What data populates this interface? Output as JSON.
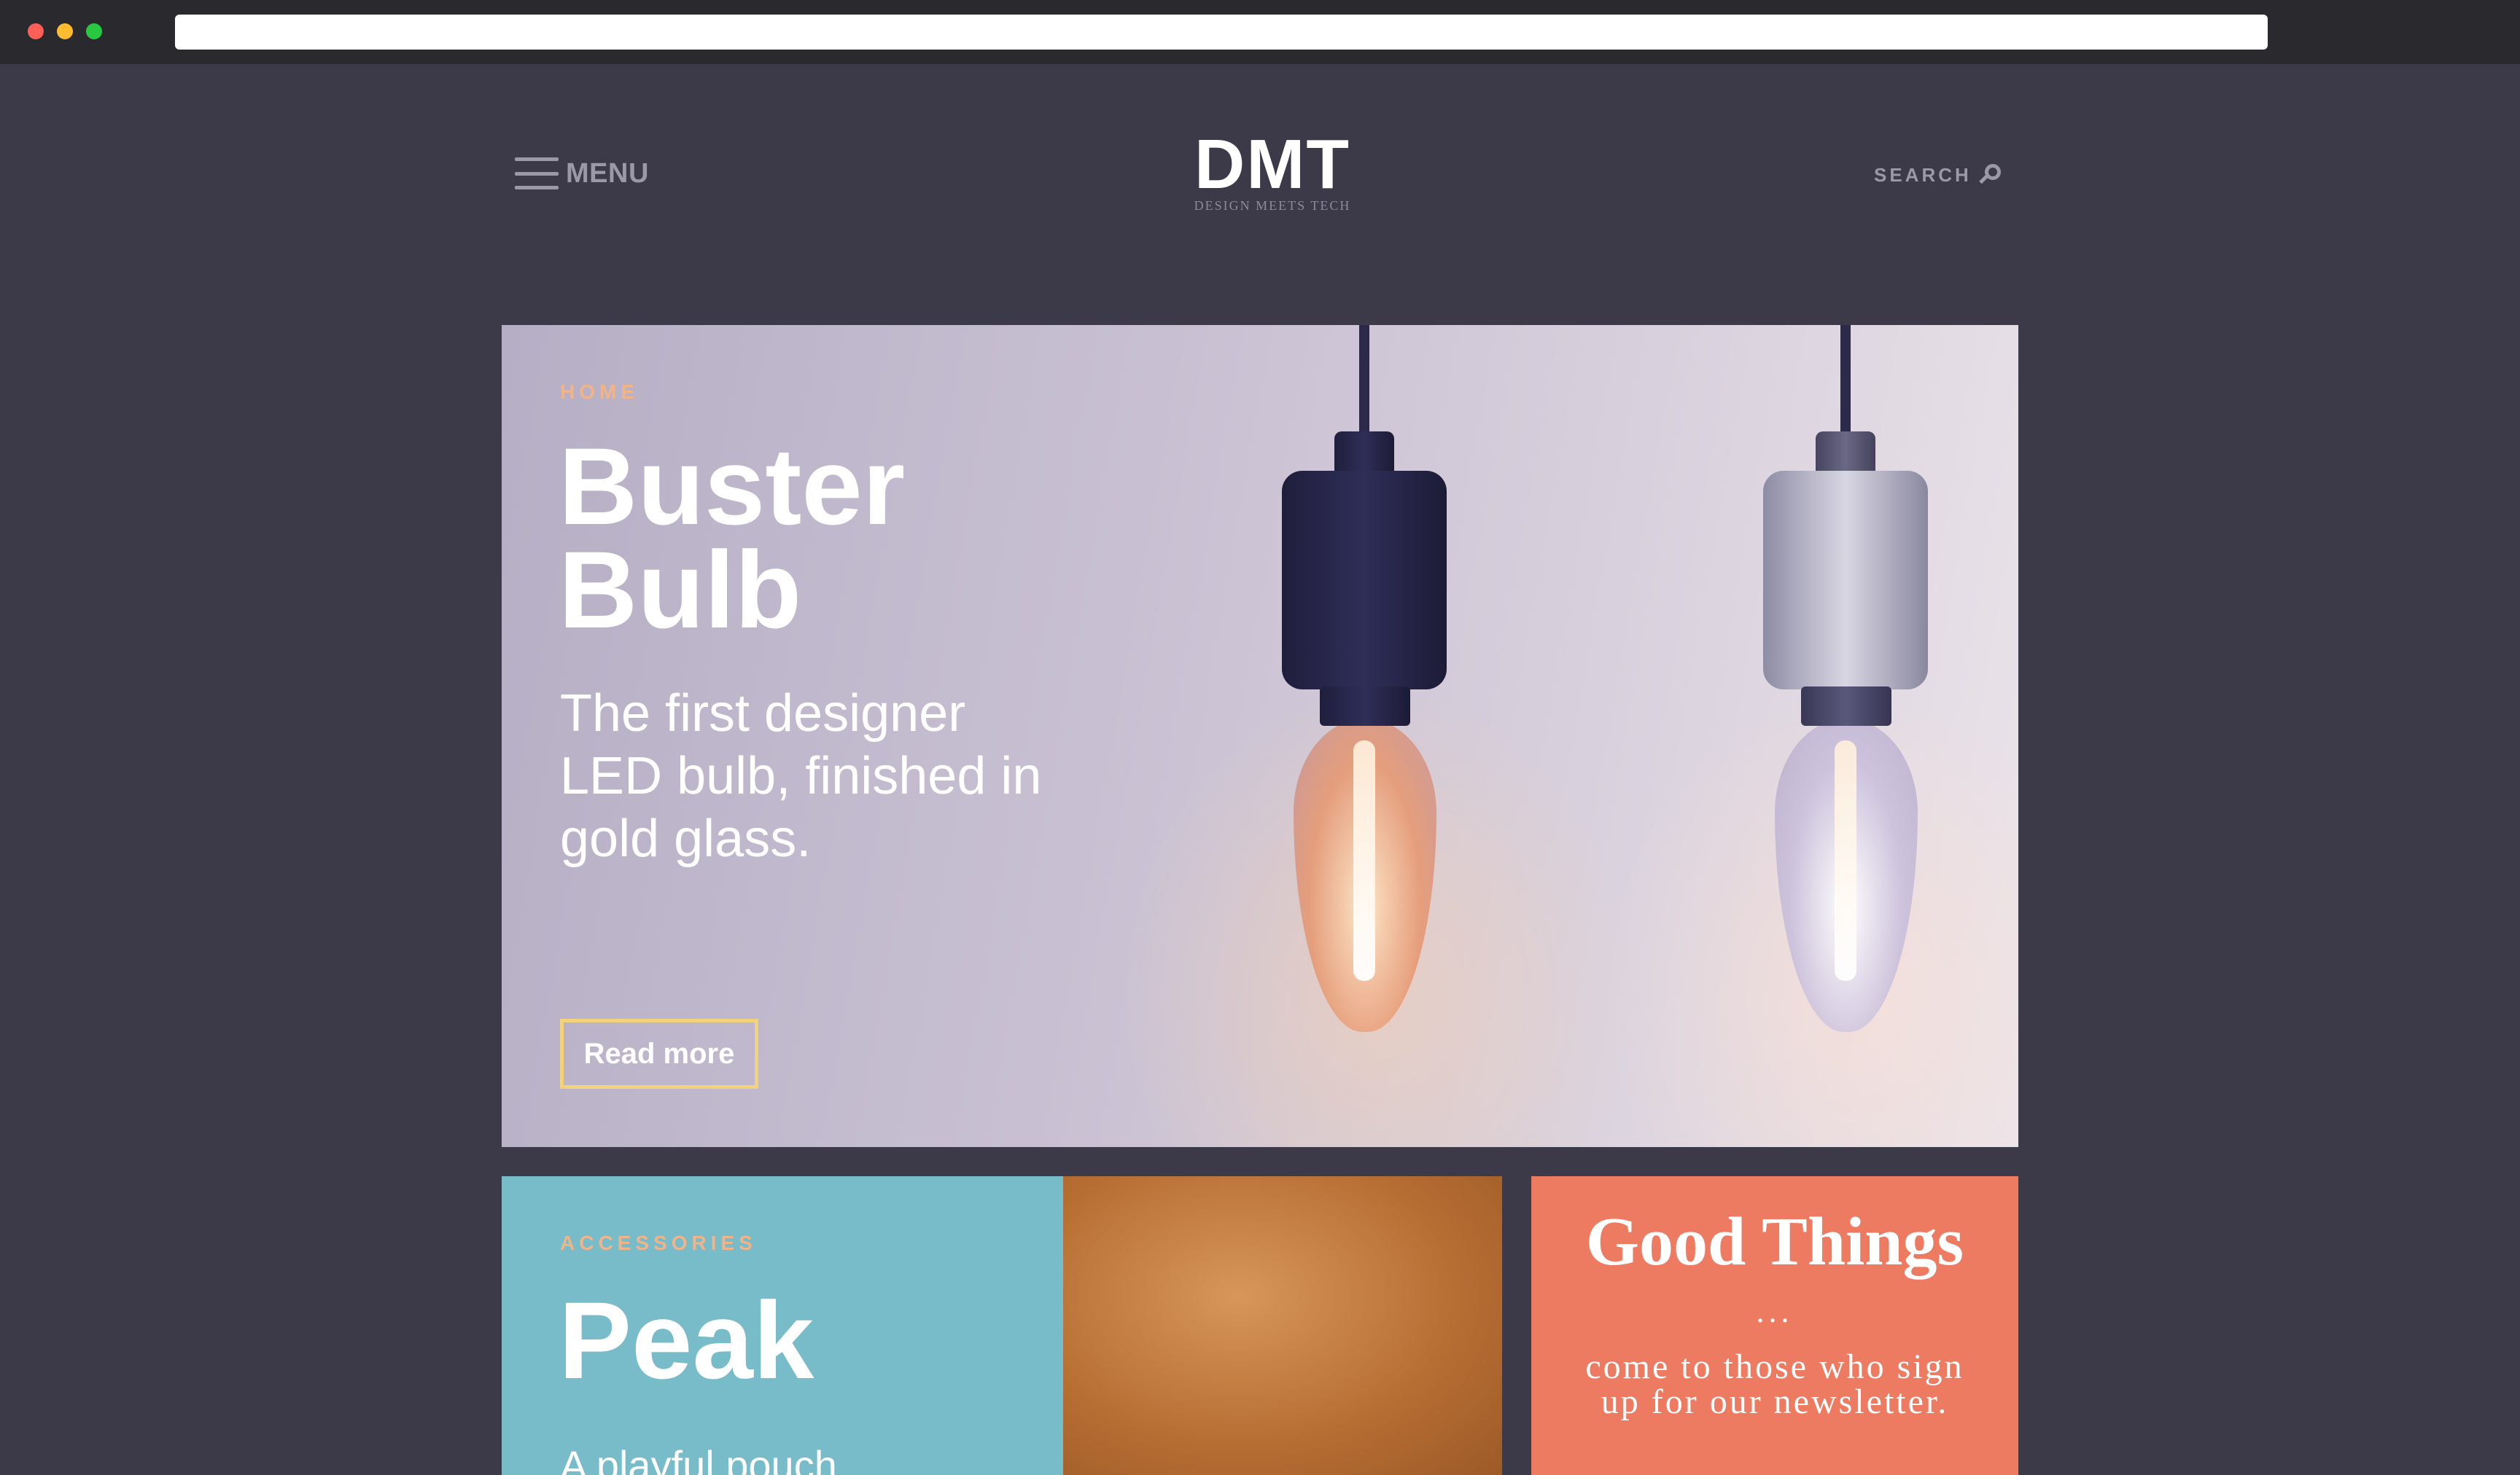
{
  "header": {
    "menu_label": "MENU",
    "logo_main": "DMT",
    "logo_sub": "DESIGN MEETS TECH",
    "search_label": "SEARCH"
  },
  "hero": {
    "category": "HOME",
    "title": "Buster Bulb",
    "subtitle": "The first designer LED bulb, finished in gold glass.",
    "button_label": "Read more"
  },
  "accessories_card": {
    "category": "ACCESSORIES",
    "title": "Peak",
    "subtitle": "A playful pouch"
  },
  "newsletter_card": {
    "title": "Good Things",
    "ellipsis": "...",
    "subtitle": "come to those who sign up for our newsletter."
  },
  "colors": {
    "page_background": "#3c3a49",
    "eyebrow": "#f0b48a",
    "button_border": "#f3d27c",
    "accessories_bg": "#78bbc9",
    "newsletter_bg": "#ec7b62"
  }
}
